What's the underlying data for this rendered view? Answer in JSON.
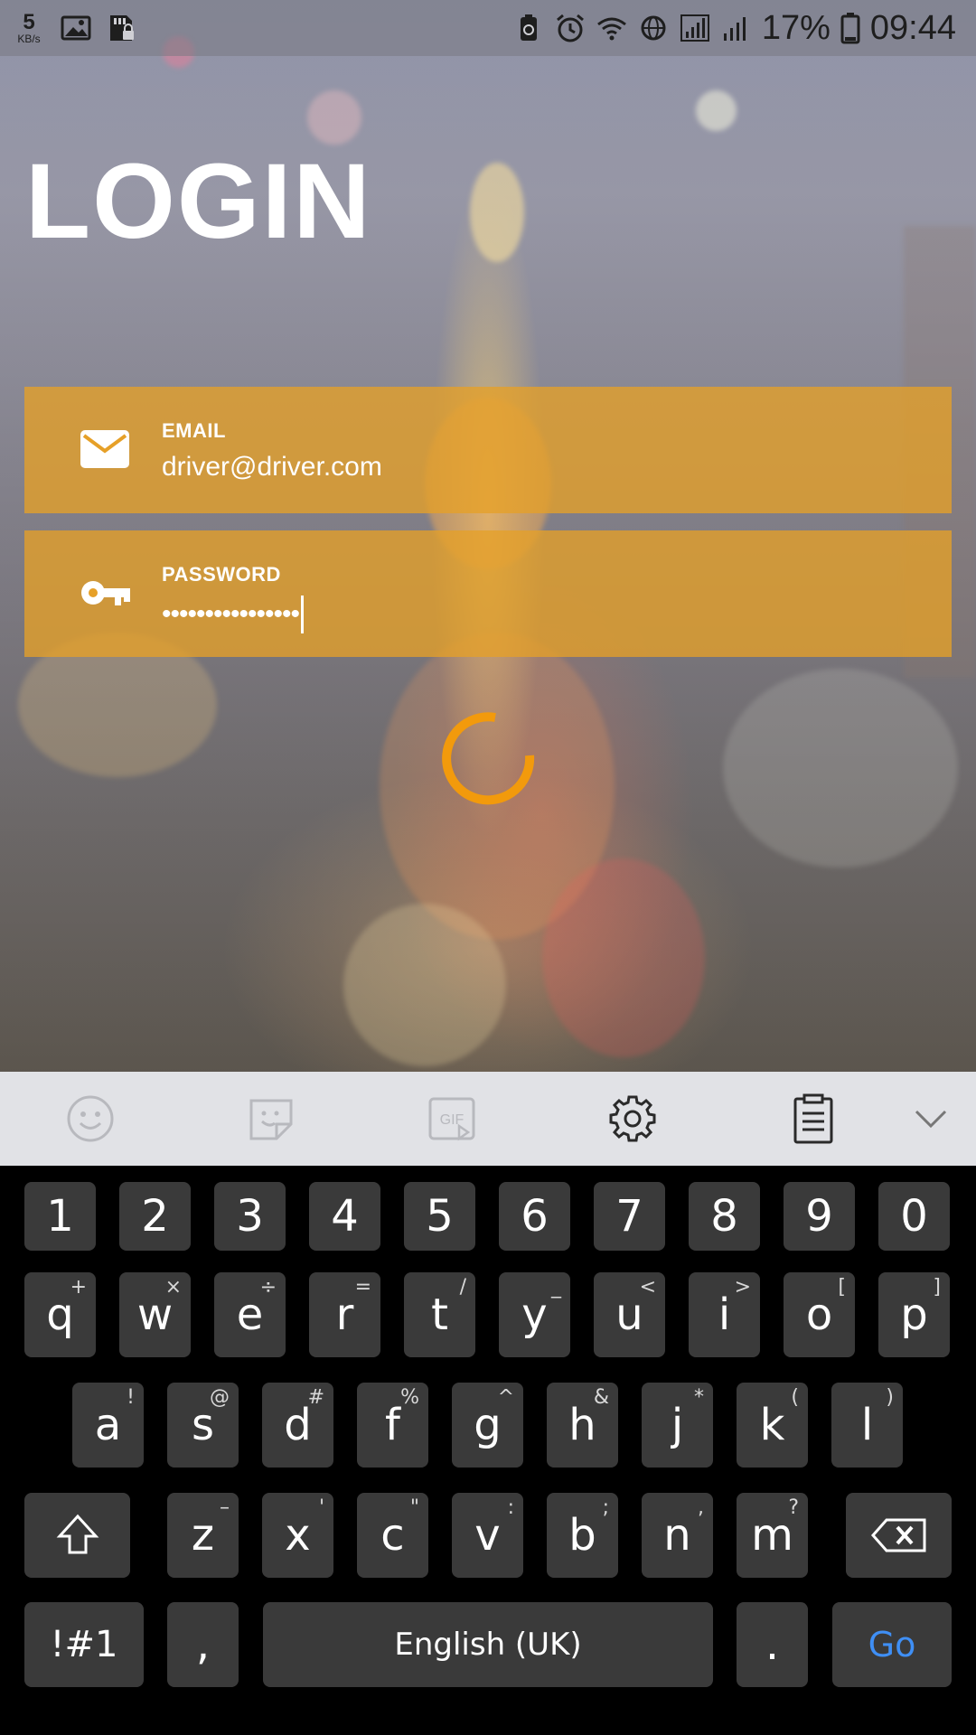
{
  "status_bar": {
    "speed_value": "5",
    "speed_unit": "KB/s",
    "battery_percent": "17%",
    "time": "09:44"
  },
  "login": {
    "title": "LOGIN",
    "email": {
      "label": "EMAIL",
      "value": "driver@driver.com",
      "icon": "envelope-icon"
    },
    "password": {
      "label": "PASSWORD",
      "masked_value": "••••••••••••••••",
      "icon": "key-icon"
    }
  },
  "keyboard_toolbar": {
    "items": [
      "emoji-icon",
      "sticker-icon",
      "gif-icon",
      "gear-icon",
      "clipboard-icon",
      "chevron-down-icon"
    ],
    "gif_label": "GIF"
  },
  "keyboard": {
    "number_row": [
      "1",
      "2",
      "3",
      "4",
      "5",
      "6",
      "7",
      "8",
      "9",
      "0"
    ],
    "row1": [
      {
        "key": "q",
        "hint": "+"
      },
      {
        "key": "w",
        "hint": "×"
      },
      {
        "key": "e",
        "hint": "÷"
      },
      {
        "key": "r",
        "hint": "="
      },
      {
        "key": "t",
        "hint": "/"
      },
      {
        "key": "y",
        "hint": "_"
      },
      {
        "key": "u",
        "hint": "<"
      },
      {
        "key": "i",
        "hint": ">"
      },
      {
        "key": "o",
        "hint": "["
      },
      {
        "key": "p",
        "hint": "]"
      }
    ],
    "row2": [
      {
        "key": "a",
        "hint": "!"
      },
      {
        "key": "s",
        "hint": "@"
      },
      {
        "key": "d",
        "hint": "#"
      },
      {
        "key": "f",
        "hint": "%"
      },
      {
        "key": "g",
        "hint": "^"
      },
      {
        "key": "h",
        "hint": "&"
      },
      {
        "key": "j",
        "hint": "*"
      },
      {
        "key": "k",
        "hint": "("
      },
      {
        "key": "l",
        "hint": ")"
      }
    ],
    "row3": [
      {
        "key": "z",
        "hint": "–"
      },
      {
        "key": "x",
        "hint": "'"
      },
      {
        "key": "c",
        "hint": "\""
      },
      {
        "key": "v",
        "hint": ":"
      },
      {
        "key": "b",
        "hint": ";"
      },
      {
        "key": "n",
        "hint": ","
      },
      {
        "key": "m",
        "hint": "?"
      }
    ],
    "symbols_label": "!#1",
    "comma_label": ",",
    "space_label": "English (UK)",
    "period_label": ".",
    "go_label": "Go"
  },
  "colors": {
    "field_background": "#e6a028",
    "spinner": "#f29a0c",
    "go_text": "#3f8ff5",
    "key_background": "#3a3a3a",
    "toolbar_background": "#e1e2e6"
  }
}
